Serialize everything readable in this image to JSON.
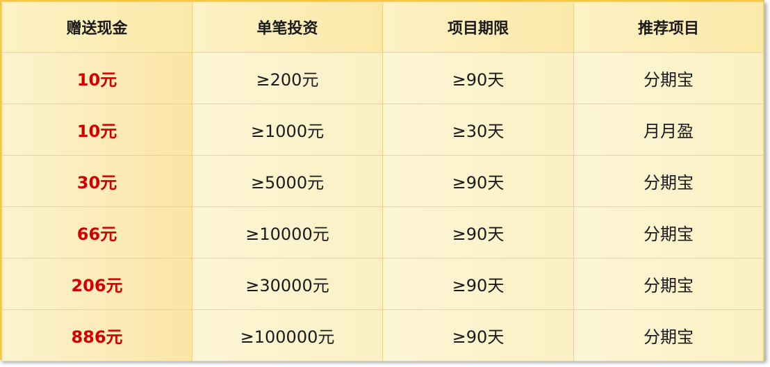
{
  "table": {
    "headers": [
      "赠送现金",
      "单笔投资",
      "项目期限",
      "推荐项目"
    ],
    "rows": [
      {
        "cash": "10元",
        "investment": "≥200元",
        "term": "≥90天",
        "project": "分期宝"
      },
      {
        "cash": "10元",
        "investment": "≥1000元",
        "term": "≥30天",
        "project": "月月盈"
      },
      {
        "cash": "30元",
        "investment": "≥5000元",
        "term": "≥90天",
        "project": "分期宝"
      },
      {
        "cash": "66元",
        "investment": "≥10000元",
        "term": "≥90天",
        "project": "分期宝"
      },
      {
        "cash": "206元",
        "investment": "≥30000元",
        "term": "≥90天",
        "project": "分期宝"
      },
      {
        "cash": "886元",
        "investment": "≥100000元",
        "term": "≥90天",
        "project": "分期宝"
      }
    ]
  },
  "colors": {
    "cash_text": "#d00000",
    "border": "#f5c842",
    "background": "#fdf3cd"
  }
}
